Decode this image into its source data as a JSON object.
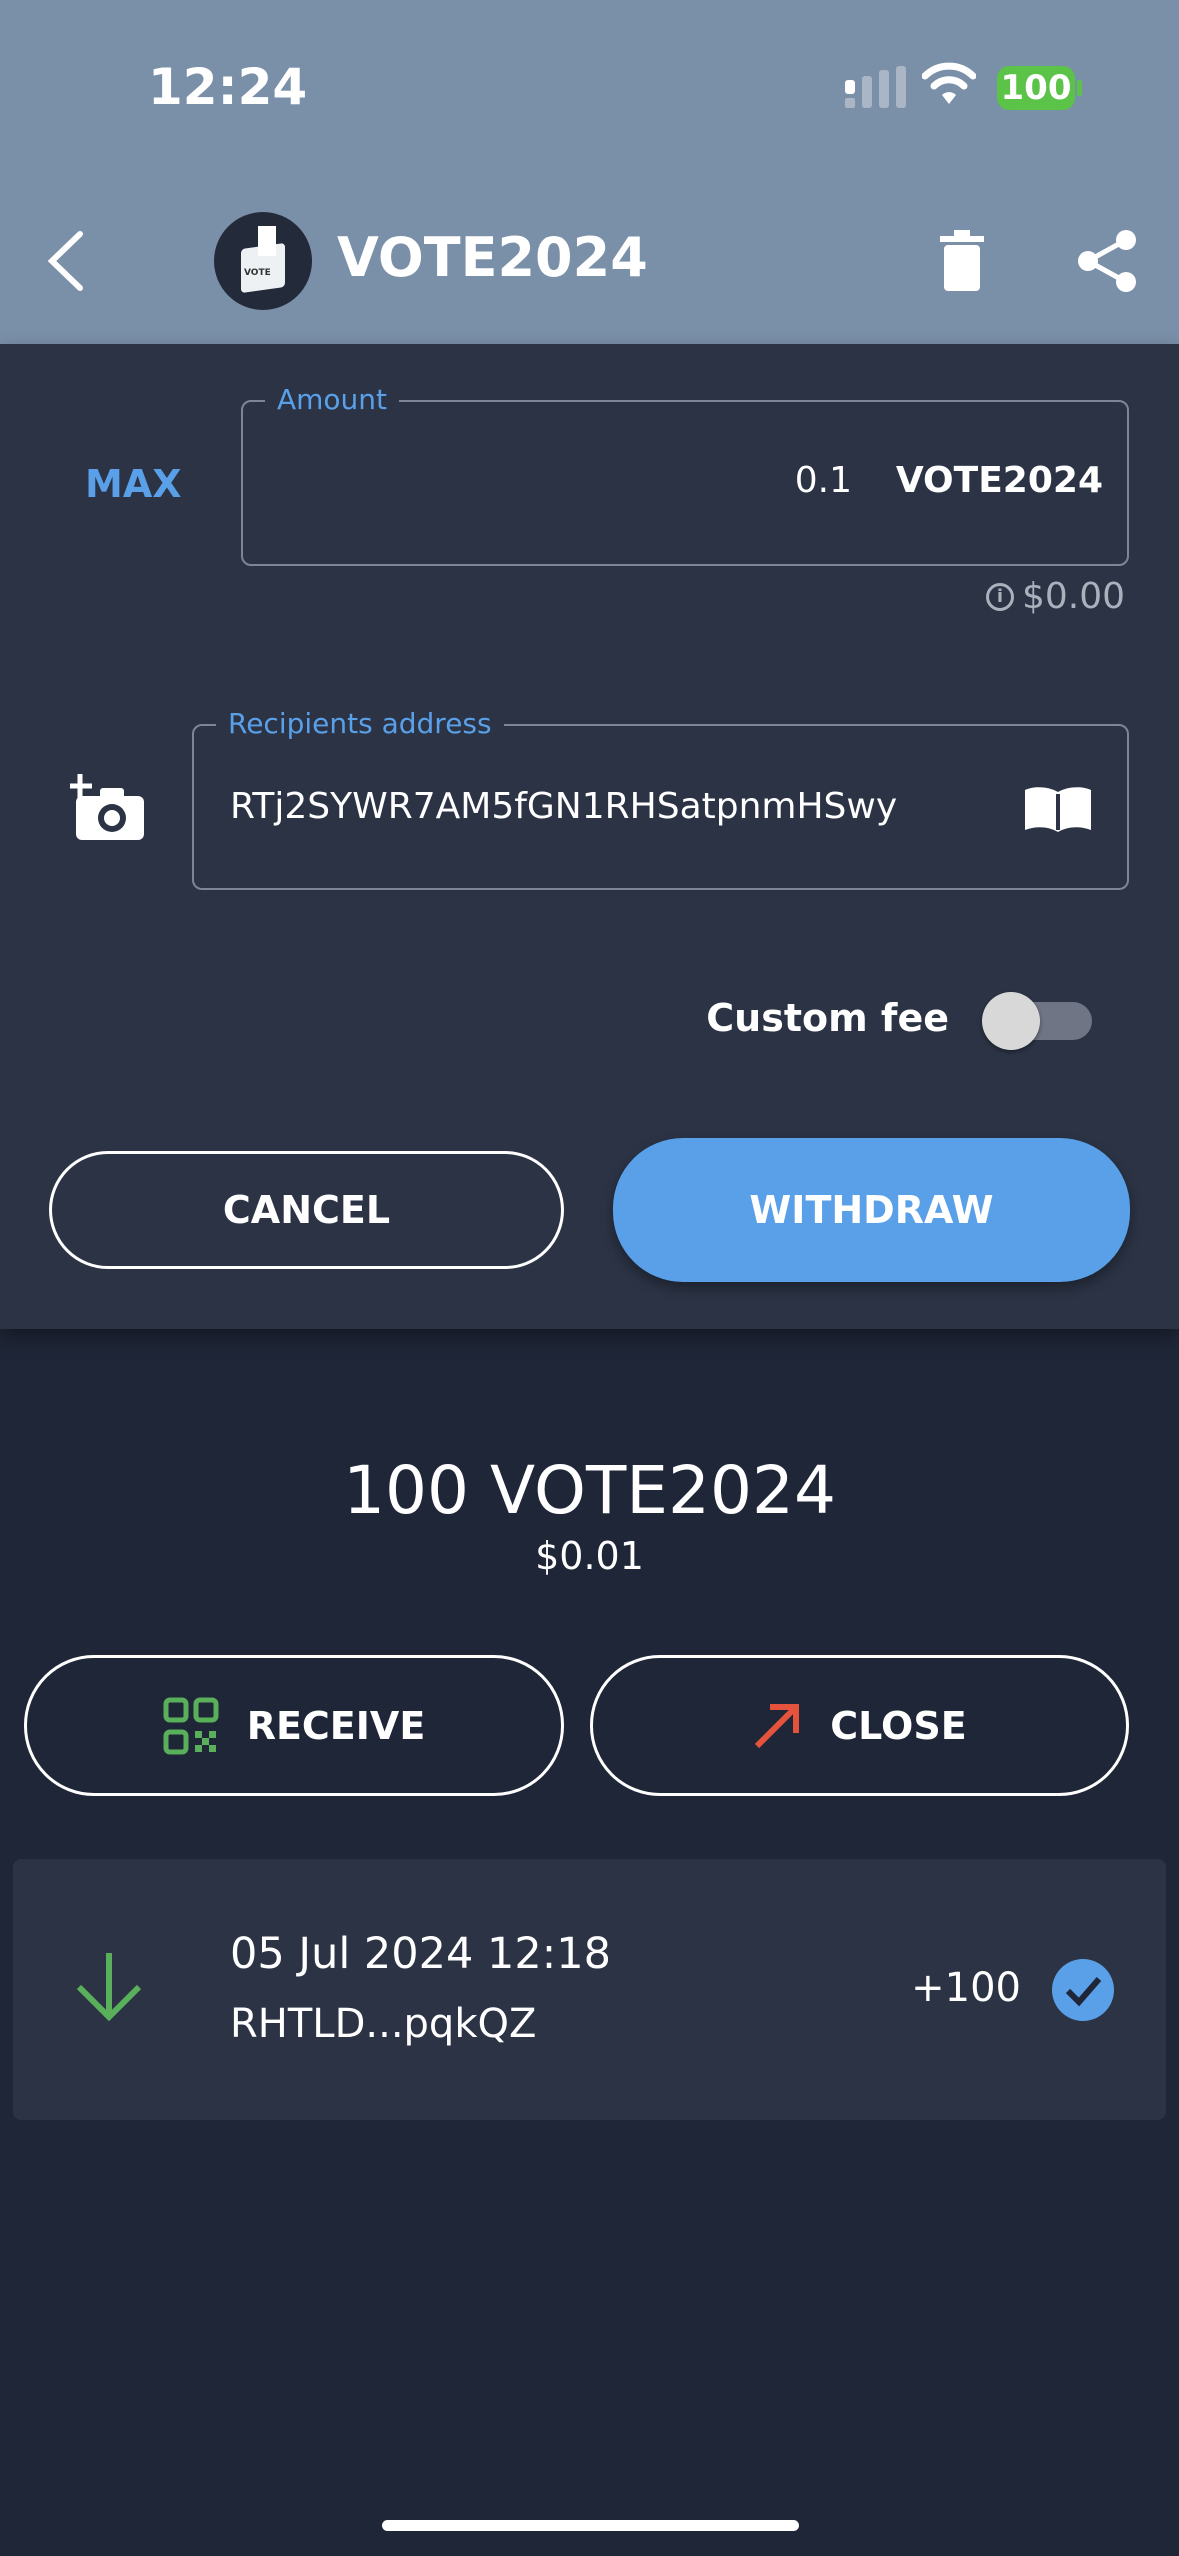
{
  "status_bar": {
    "time": "12:24",
    "battery": "100",
    "battery_color": "#5ac348"
  },
  "header": {
    "title": "VOTE2024",
    "avatar_text": "VOTE",
    "back_icon": "chevron-left-icon",
    "delete_icon": "trash-icon",
    "share_icon": "share-icon"
  },
  "withdraw_form": {
    "max_label": "MAX",
    "amount_label": "Amount",
    "amount_value": "0.1",
    "amount_unit": "VOTE2024",
    "fiat_value": "$0.00",
    "recipient_label": "Recipients address",
    "recipient_value": "RTj2SYWR7AM5fGN1RHSatpnmHSwy",
    "custom_fee_label": "Custom fee",
    "custom_fee_enabled": false,
    "cancel_label": "CANCEL",
    "withdraw_label": "WITHDRAW"
  },
  "balance": {
    "amount": "100 VOTE2024",
    "fiat": "$0.01"
  },
  "actions": {
    "receive_label": "RECEIVE",
    "close_label": "CLOSE"
  },
  "transactions": [
    {
      "date": "05 Jul 2024 12:18",
      "address": "RHTLD...pqkQZ",
      "amount": "+100",
      "direction": "incoming",
      "confirmed": true
    }
  ],
  "colors": {
    "accent": "#5aa0e8",
    "incoming": "#5ab05a",
    "outgoing": "#e5533d",
    "header_bg": "#7a8fa8",
    "panel_bg": "#2b3345",
    "page_bg": "#1f2637"
  }
}
